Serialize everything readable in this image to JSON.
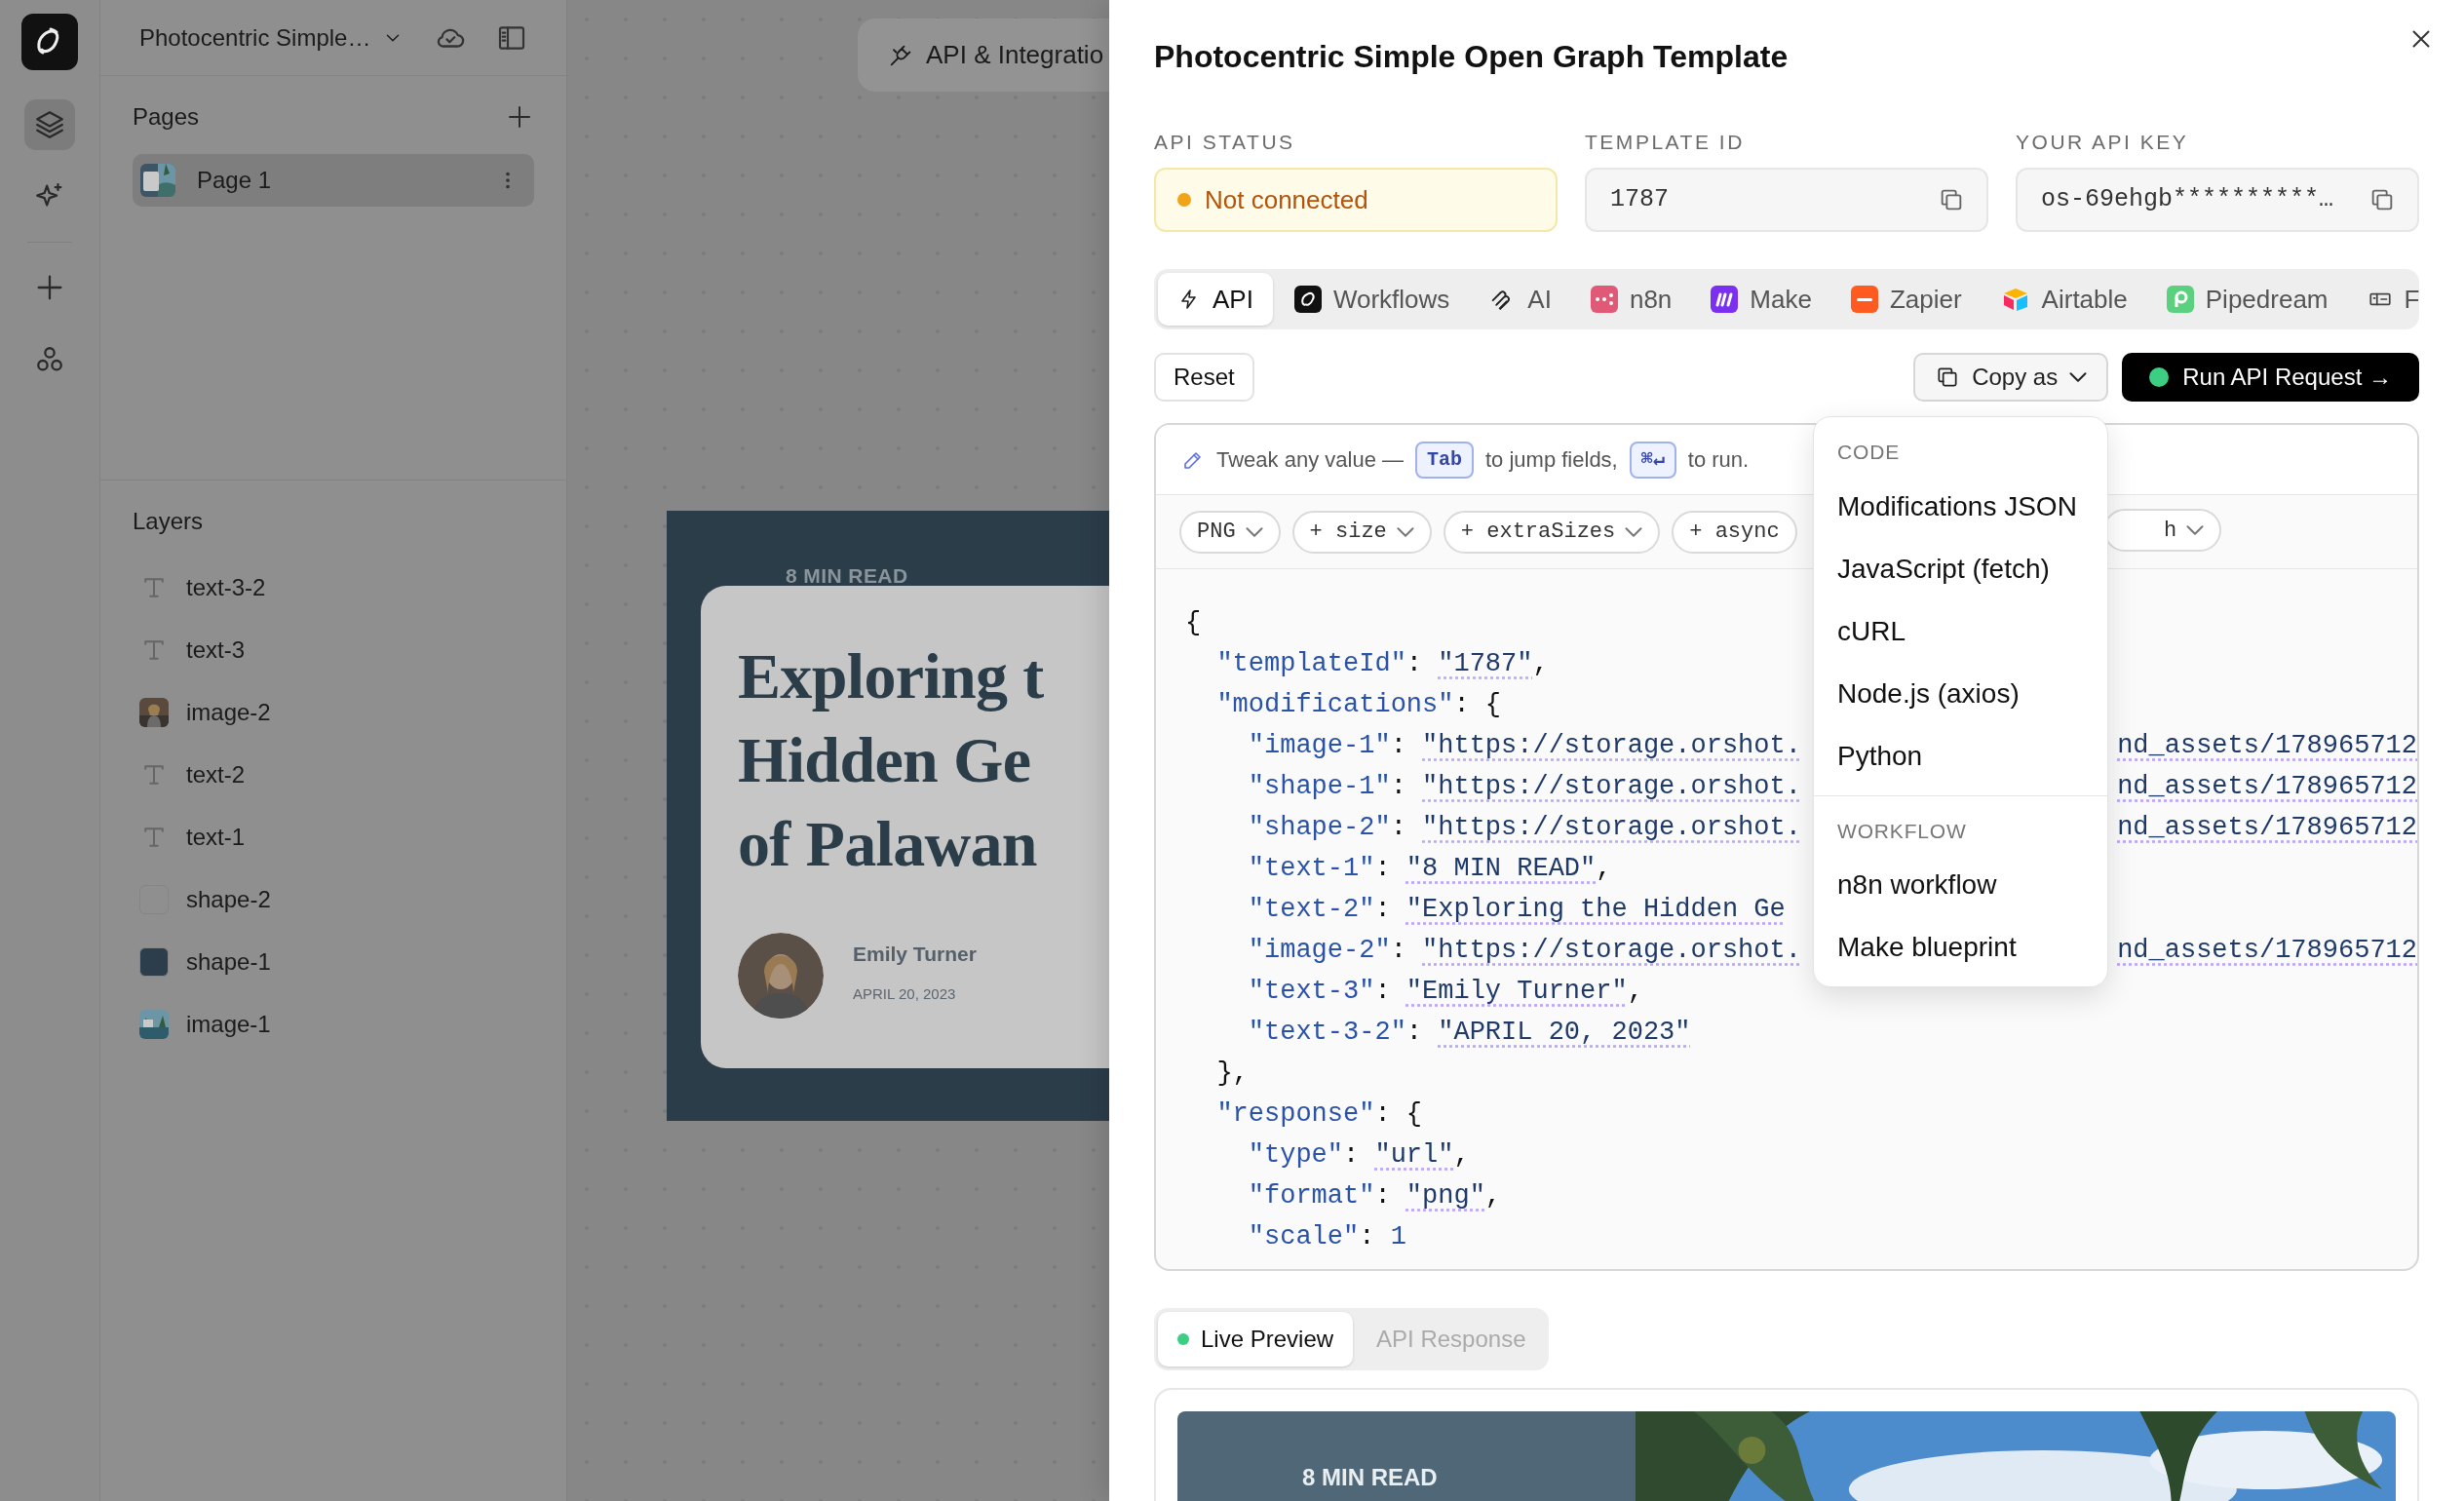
{
  "app": {
    "project_name": "Photocentric Simple…"
  },
  "rail_items": [
    {
      "selected": true
    },
    {
      "selected": false
    },
    {
      "selected": false
    },
    {
      "selected": false
    }
  ],
  "pages": {
    "title": "Pages",
    "items": [
      {
        "label": "Page 1",
        "selected": true
      }
    ]
  },
  "layers": {
    "title": "Layers",
    "items": [
      {
        "kind": "text",
        "label": "text-3-2"
      },
      {
        "kind": "text",
        "label": "text-3"
      },
      {
        "label": "image-2"
      },
      {
        "kind": "text",
        "label": "text-2"
      },
      {
        "kind": "text",
        "label": "text-1"
      },
      {
        "kind": "shape",
        "label": "shape-2",
        "color": "#8f8f8f"
      },
      {
        "kind": "shape",
        "label": "shape-1",
        "color": "#2c3e4c"
      },
      {
        "label": "image-1"
      }
    ]
  },
  "canvas": {
    "integration_button": "API & Integratio",
    "design": {
      "eyebrow": "8 MIN READ",
      "headline": [
        "Exploring t",
        "Hidden Ge",
        "of Palawan"
      ],
      "author": "Emily Turner",
      "date": "APRIL 20, 2023"
    }
  },
  "drawer": {
    "title": "Photocentric Simple Open Graph Template",
    "fields": [
      {
        "label": "API STATUS",
        "value": "Not connected",
        "kind": "status"
      },
      {
        "label": "TEMPLATE ID",
        "value": "1787",
        "kind": "copy"
      },
      {
        "label": "YOUR API KEY",
        "value": "os-69ehgb**********…",
        "kind": "copy"
      }
    ],
    "tabs": [
      {
        "label": "API",
        "selected": true
      },
      {
        "label": "Workflows",
        "selected": false
      },
      {
        "label": "AI",
        "selected": false
      },
      {
        "label": "n8n",
        "selected": false
      },
      {
        "label": "Make",
        "selected": false
      },
      {
        "label": "Zapier",
        "selected": false
      },
      {
        "label": "Airtable",
        "selected": false
      },
      {
        "label": "Pipedream",
        "selected": false
      },
      {
        "label": "F",
        "selected": false
      }
    ],
    "reset": "Reset",
    "copy_as": "Copy as",
    "run": "Run API Request →",
    "editor": {
      "hint": [
        {
          "kind": "text",
          "text": "Tweak any value —"
        },
        {
          "kind": "key",
          "text": "Tab"
        },
        {
          "kind": "text",
          "text": "to jump fields,"
        },
        {
          "kind": "key",
          "text": "⌘↵"
        },
        {
          "kind": "text",
          "text": "to run."
        }
      ],
      "chips": [
        {
          "label": "PNG",
          "kind": "select"
        },
        {
          "label": "+ size",
          "kind": "select"
        },
        {
          "label": "+ extraSizes",
          "kind": "select"
        },
        {
          "label": "+ async",
          "kind": "plain"
        },
        {
          "label": "h",
          "kind": "behind_menu"
        }
      ],
      "code": [
        {
          "tokens": [
            {
              "kind": "punct",
              "text": "{"
            }
          ]
        },
        {
          "tokens": [
            {
              "kind": "key",
              "text": "  \"templateId\""
            },
            {
              "kind": "punct",
              "text": ": "
            },
            {
              "kind": "string",
              "text": "\"1787\""
            },
            {
              "kind": "punct",
              "text": ","
            }
          ]
        },
        {
          "tokens": [
            {
              "kind": "key",
              "text": "  \"modifications\""
            },
            {
              "kind": "punct",
              "text": ": {"
            }
          ]
        },
        {
          "tokens": [
            {
              "kind": "key",
              "text": "    \"image-1\""
            },
            {
              "kind": "punct",
              "text": ": "
            },
            {
              "kind": "string",
              "text": "\"https://storage.orshot."
            }
          ],
          "tail": "nd_assets/178965712"
        },
        {
          "tokens": [
            {
              "kind": "key",
              "text": "    \"shape-1\""
            },
            {
              "kind": "punct",
              "text": ": "
            },
            {
              "kind": "string",
              "text": "\"https://storage.orshot."
            }
          ],
          "tail": "nd_assets/178965712"
        },
        {
          "tokens": [
            {
              "kind": "key",
              "text": "    \"shape-2\""
            },
            {
              "kind": "punct",
              "text": ": "
            },
            {
              "kind": "string",
              "text": "\"https://storage.orshot."
            }
          ],
          "tail": "nd_assets/178965712"
        },
        {
          "tokens": [
            {
              "kind": "key",
              "text": "    \"text-1\""
            },
            {
              "kind": "punct",
              "text": ": "
            },
            {
              "kind": "string",
              "text": "\"8 MIN READ\""
            },
            {
              "kind": "punct",
              "text": ","
            }
          ]
        },
        {
          "tokens": [
            {
              "kind": "key",
              "text": "    \"text-2\""
            },
            {
              "kind": "punct",
              "text": ": "
            },
            {
              "kind": "string",
              "text": "\"Exploring the Hidden Ge"
            }
          ]
        },
        {
          "tokens": [
            {
              "kind": "key",
              "text": "    \"image-2\""
            },
            {
              "kind": "punct",
              "text": ": "
            },
            {
              "kind": "string",
              "text": "\"https://storage.orshot."
            }
          ],
          "tail": "nd_assets/178965712"
        },
        {
          "tokens": [
            {
              "kind": "key",
              "text": "    \"text-3\""
            },
            {
              "kind": "punct",
              "text": ": "
            },
            {
              "kind": "string",
              "text": "\"Emily Turner\""
            },
            {
              "kind": "punct",
              "text": ","
            }
          ]
        },
        {
          "tokens": [
            {
              "kind": "key",
              "text": "    \"text-3-2\""
            },
            {
              "kind": "punct",
              "text": ": "
            },
            {
              "kind": "string",
              "text": "\"APRIL 20, 2023\""
            }
          ]
        },
        {
          "tokens": [
            {
              "kind": "punct",
              "text": "  },"
            }
          ]
        },
        {
          "tokens": [
            {
              "kind": "key",
              "text": "  \"response\""
            },
            {
              "kind": "punct",
              "text": ": {"
            }
          ]
        },
        {
          "tokens": [
            {
              "kind": "key",
              "text": "    \"type\""
            },
            {
              "kind": "punct",
              "text": ": "
            },
            {
              "kind": "string",
              "text": "\"url\""
            },
            {
              "kind": "punct",
              "text": ","
            }
          ]
        },
        {
          "tokens": [
            {
              "kind": "key",
              "text": "    \"format\""
            },
            {
              "kind": "punct",
              "text": ": "
            },
            {
              "kind": "string",
              "text": "\"png\""
            },
            {
              "kind": "punct",
              "text": ","
            }
          ]
        },
        {
          "tokens": [
            {
              "kind": "key",
              "text": "    \"scale\""
            },
            {
              "kind": "punct",
              "text": ": "
            },
            {
              "kind": "number",
              "text": "1"
            }
          ]
        }
      ]
    },
    "menu": {
      "sections": [
        {
          "title": "CODE",
          "items": [
            "Modifications JSON",
            "JavaScript (fetch)",
            "cURL",
            "Node.js (axios)",
            "Python"
          ]
        },
        {
          "title": "WORKFLOW",
          "items": [
            "n8n workflow",
            "Make blueprint"
          ]
        }
      ]
    },
    "result_tabs": [
      {
        "label": "Live Preview",
        "selected": true
      },
      {
        "label": "API Response",
        "selected": false
      }
    ],
    "preview": {
      "eyebrow": "8 MIN READ"
    }
  }
}
